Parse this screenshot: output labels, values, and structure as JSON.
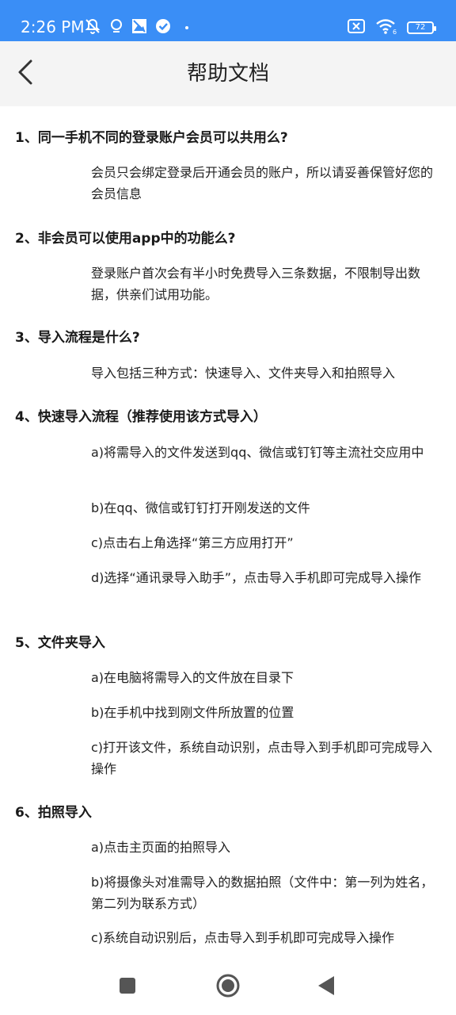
{
  "status_bar": {
    "time": "2:26 PM",
    "battery": "72",
    "icons": [
      "mute-icon",
      "location-icon",
      "image-icon",
      "check-icon",
      "no-sim-icon",
      "wifi-icon",
      "battery-icon"
    ]
  },
  "header": {
    "title": "帮助文档",
    "back_icon": "chevron-left-icon"
  },
  "faq": [
    {
      "question": "1、同一手机不同的登录账户会员可以共用么?",
      "answers": [
        "会员只会绑定登录后开通会员的账户，所以请妥善保管好您的会员信息"
      ]
    },
    {
      "question": "2、非会员可以使用app中的功能么?",
      "answers": [
        "登录账户首次会有半小时免费导入三条数据，不限制导出数据，供亲们试用功能。"
      ]
    },
    {
      "question": "3、导入流程是什么?",
      "answers": [
        "导入包括三种方式：快速导入、文件夹导入和拍照导入"
      ]
    },
    {
      "question": "4、快速导入流程（推荐使用该方式导入）",
      "answers": [
        "a)将需导入的文件发送到qq、微信或钉钉等主流社交应用中",
        "b)在qq、微信或钉钉打开刚发送的文件",
        "c)点击右上角选择“第三方应用打开”",
        "d)选择“通讯录导入助手”，点击导入手机即可完成导入操作"
      ]
    },
    {
      "question": "5、文件夹导入",
      "answers": [
        "a)在电脑将需导入的文件放在目录下",
        "b)在手机中找到刚文件所放置的位置",
        "c)打开该文件，系统自动识别，点击导入到手机即可完成导入操作"
      ]
    },
    {
      "question": "6、拍照导入",
      "answers": [
        "a)点击主页面的拍照导入",
        "b)将摄像头对准需导入的数据拍照（文件中：第一列为姓名，第二列为联系方式）",
        "c)系统自动识别后，点击导入到手机即可完成导入操作"
      ]
    }
  ],
  "nav_bar": {
    "buttons": [
      "recents-square-icon",
      "home-circle-icon",
      "back-triangle-icon"
    ]
  }
}
